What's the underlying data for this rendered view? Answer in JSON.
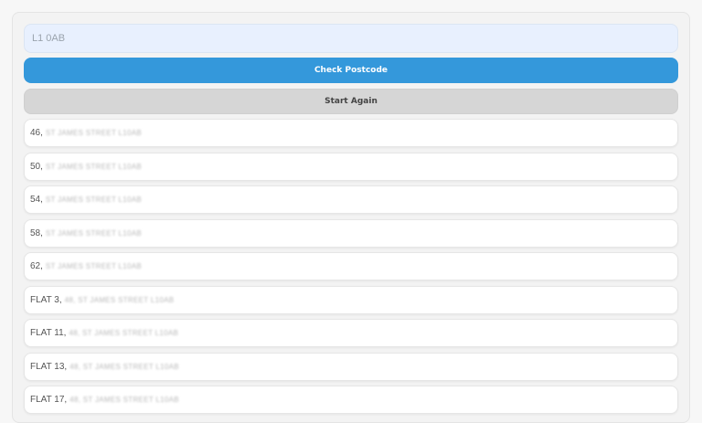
{
  "search": {
    "value": "L1 0AB",
    "check_label": "Check Postcode",
    "reset_label": "Start Again"
  },
  "addresses": [
    {
      "house": "46,",
      "rest": "ST JAMES STREET L10AB"
    },
    {
      "house": "50,",
      "rest": "ST JAMES STREET L10AB"
    },
    {
      "house": "54,",
      "rest": "ST JAMES STREET L10AB"
    },
    {
      "house": "58,",
      "rest": "ST JAMES STREET L10AB"
    },
    {
      "house": "62,",
      "rest": "ST JAMES STREET L10AB"
    },
    {
      "house": "FLAT 3,",
      "rest": "48, ST JAMES STREET L10AB"
    },
    {
      "house": "FLAT 11,",
      "rest": "48, ST JAMES STREET L10AB"
    },
    {
      "house": "FLAT 13,",
      "rest": "48, ST JAMES STREET L10AB"
    },
    {
      "house": "FLAT 17,",
      "rest": "48, ST JAMES STREET L10AB"
    }
  ],
  "colors": {
    "primary": "#3498db",
    "secondary": "#d6d6d6",
    "input_bg": "#e8f0fe"
  }
}
